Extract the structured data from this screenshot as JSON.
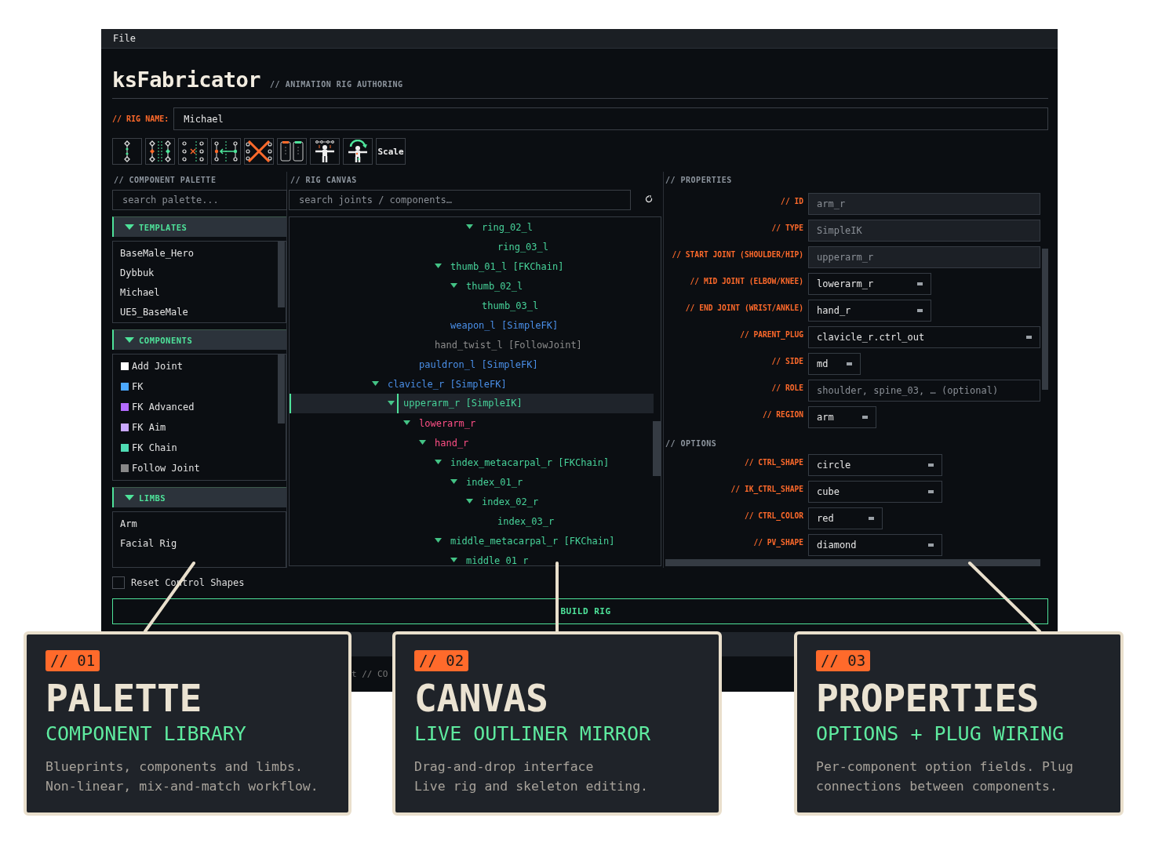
{
  "menu": [
    {
      "label": "File"
    }
  ],
  "app": {
    "title": "ksFabricator",
    "subtitle": "// ANIMATION RIG AUTHORING"
  },
  "rig_name": {
    "label": "// RIG NAME:",
    "value": "Michael"
  },
  "toolbar": [
    {
      "kind": "icon"
    },
    {
      "kind": "icon"
    },
    {
      "kind": "icon"
    },
    {
      "kind": "icon"
    },
    {
      "kind": "icon"
    },
    {
      "kind": "icon"
    },
    {
      "kind": "icon"
    },
    {
      "kind": "icon"
    },
    {
      "kind": "text",
      "label": "Scale"
    }
  ],
  "palette": {
    "heading": "// COMPONENT PALETTE",
    "search": {
      "placeholder": "search palette..."
    },
    "sections": [
      {
        "title": "TEMPLATES",
        "expanded": true,
        "items": [
          {
            "label": "BaseMale_Hero"
          },
          {
            "label": "Dybbuk"
          },
          {
            "label": "Michael"
          },
          {
            "label": "UE5_BaseMale"
          }
        ]
      },
      {
        "title": "COMPONENTS",
        "expanded": true,
        "items": [
          {
            "label": "Add Joint",
            "color": "#ffffff"
          },
          {
            "label": "FK",
            "color": "#4ba8ff"
          },
          {
            "label": "FK Advanced",
            "color": "#b36bff"
          },
          {
            "label": "FK Aim",
            "color": "#c9a8ff"
          },
          {
            "label": "FK Chain",
            "color": "#4fdcb4"
          },
          {
            "label": "Follow Joint",
            "color": "#888888"
          }
        ]
      },
      {
        "title": "LIMBS",
        "expanded": true,
        "items": [
          {
            "label": "Arm"
          },
          {
            "label": "Facial Rig"
          }
        ]
      }
    ]
  },
  "canvas": {
    "heading": "// RIG CANVAS",
    "search": {
      "placeholder": "search joints / components…"
    },
    "tree": [
      {
        "children": [
          {
            "children": [
              {
                "children": [
                  {
                    "children": [
                      {
                        "children": [
                          {
                            "children": [
                              {
                                "label": "ring_02_l",
                                "color": "#47d39a",
                                "expanded": true,
                                "selected": false,
                                "children": [
                                  {
                                    "label": "ring_03_l",
                                    "color": "#47d39a",
                                    "selected": false
                                  }
                                ]
                              }
                            ]
                          }
                        ]
                      },
                      {
                        "label": "thumb_01_l [FKChain]",
                        "color": "#47d39a",
                        "expanded": true,
                        "selected": false,
                        "children": [
                          {
                            "label": "thumb_02_l",
                            "color": "#47d39a",
                            "expanded": true,
                            "selected": false,
                            "children": [
                              {
                                "label": "thumb_03_l",
                                "color": "#47d39a",
                                "selected": false
                              }
                            ]
                          }
                        ]
                      },
                      {
                        "label": "weapon_l [SimpleFK]",
                        "color": "#4a8fe8",
                        "selected": false
                      }
                    ]
                  },
                  {
                    "label": "hand_twist_l [FollowJoint]",
                    "color": "#8c8c8c",
                    "selected": false
                  }
                ]
              },
              {
                "label": "pauldron_l [SimpleFK]",
                "color": "#4a8fe8",
                "selected": false
              }
            ]
          }
        ]
      },
      {
        "label": "clavicle_r [SimpleFK]",
        "color": "#4a8fe8",
        "expanded": true,
        "selected": false,
        "children": [
          {
            "label": "upperarm_r [SimpleIK]",
            "color": "#47d39a",
            "expanded": true,
            "selected": true,
            "children": [
              {
                "label": "lowerarm_r",
                "color": "#ff4f86",
                "expanded": true,
                "selected": false,
                "children": [
                  {
                    "label": "hand_r",
                    "color": "#ff4f86",
                    "expanded": true,
                    "selected": false,
                    "children": [
                      {
                        "label": "index_metacarpal_r [FKChain]",
                        "color": "#47d39a",
                        "expanded": true,
                        "selected": false,
                        "children": [
                          {
                            "label": "index_01_r",
                            "color": "#47d39a",
                            "expanded": true,
                            "selected": false,
                            "children": [
                              {
                                "label": "index_02_r",
                                "color": "#47d39a",
                                "expanded": true,
                                "selected": false,
                                "children": [
                                  {
                                    "label": "index_03_r",
                                    "color": "#47d39a",
                                    "selected": false
                                  }
                                ]
                              }
                            ]
                          }
                        ]
                      },
                      {
                        "label": "middle_metacarpal_r [FKChain]",
                        "color": "#47d39a",
                        "expanded": true,
                        "selected": false,
                        "children": [
                          {
                            "label": "middle_01_r",
                            "color": "#47d39a",
                            "expanded": true,
                            "selected": false
                          }
                        ]
                      }
                    ]
                  }
                ]
              }
            ]
          }
        ]
      }
    ]
  },
  "properties": {
    "heading": "// PROPERTIES",
    "fields": [
      {
        "label": "// ID",
        "kind": "readonly",
        "value": "arm_r"
      },
      {
        "label": "// TYPE",
        "kind": "readonly",
        "value": "SimpleIK"
      },
      {
        "label": "// START JOINT (SHOULDER/HIP)",
        "kind": "readonly",
        "value": "upperarm_r"
      },
      {
        "label": "// MID JOINT (ELBOW/KNEE)",
        "kind": "dropdown",
        "value": "lowerarm_r"
      },
      {
        "label": "// END JOINT (WRIST/ANKLE)",
        "kind": "dropdown",
        "value": "hand_r"
      },
      {
        "label": "// PARENT_PLUG",
        "kind": "dropdown",
        "value": "clavicle_r.ctrl_out"
      },
      {
        "label": "// SIDE",
        "kind": "dropdown",
        "value": "md"
      },
      {
        "label": "// ROLE",
        "kind": "text",
        "placeholder": "shoulder, spine_03, … (optional)"
      },
      {
        "label": "// REGION",
        "kind": "dropdown",
        "value": "arm"
      }
    ],
    "options_heading": "// OPTIONS",
    "options": [
      {
        "label": "// CTRL_SHAPE",
        "kind": "dropdown",
        "value": "circle"
      },
      {
        "label": "// IK_CTRL_SHAPE",
        "kind": "dropdown",
        "value": "cube"
      },
      {
        "label": "// CTRL_COLOR",
        "kind": "dropdown",
        "value": "red"
      },
      {
        "label": "// PV_SHAPE",
        "kind": "dropdown",
        "value": "diamond"
      }
    ]
  },
  "reset_checkbox": {
    "label": "Reset Control Shapes",
    "checked": false
  },
  "build_button": {
    "label": "BUILD RIG"
  },
  "status_bar": {
    "text": "t // CO"
  },
  "callouts": [
    {
      "badge": "// 01",
      "title": "PALETTE",
      "subtitle": "COMPONENT LIBRARY",
      "description_lines": [
        "Blueprints, components and limbs.",
        "Non-linear, mix-and-match workflow."
      ]
    },
    {
      "badge": "// 02",
      "title": "CANVAS",
      "subtitle": "LIVE OUTLINER MIRROR",
      "description_lines": [
        "Drag-and-drop interface",
        "Live rig and skeleton editing."
      ]
    },
    {
      "badge": "// 03",
      "title": "PROPERTIES",
      "subtitle": "OPTIONS + PLUG WIRING",
      "description_lines": [
        "Per-component option fields. Plug",
        "connections between components."
      ]
    }
  ]
}
